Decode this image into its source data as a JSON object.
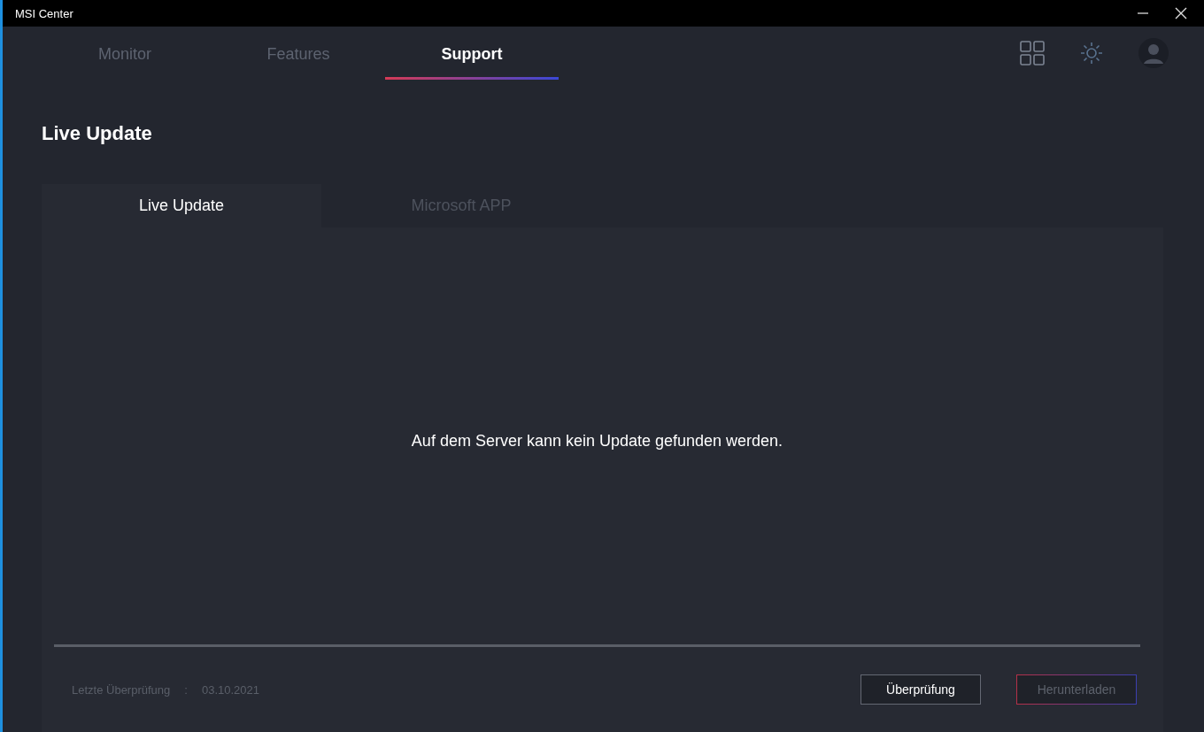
{
  "window": {
    "title": "MSI Center"
  },
  "nav_tabs": [
    {
      "label": "Monitor",
      "selected": false
    },
    {
      "label": "Features",
      "selected": false
    },
    {
      "label": "Support",
      "selected": true
    }
  ],
  "page_title": "Live Update",
  "sub_tabs": [
    {
      "label": "Live Update",
      "selected": true
    },
    {
      "label": "Microsoft APP",
      "selected": false
    }
  ],
  "message": "Auf dem Server kann kein Update gefunden werden.",
  "last_check": {
    "label": "Letzte Überprüfung",
    "separator": ":",
    "value": "03.10.2021"
  },
  "buttons": [
    {
      "label": "Überprüfung",
      "disabled": false
    },
    {
      "label": "Herunterladen",
      "disabled": true
    }
  ]
}
